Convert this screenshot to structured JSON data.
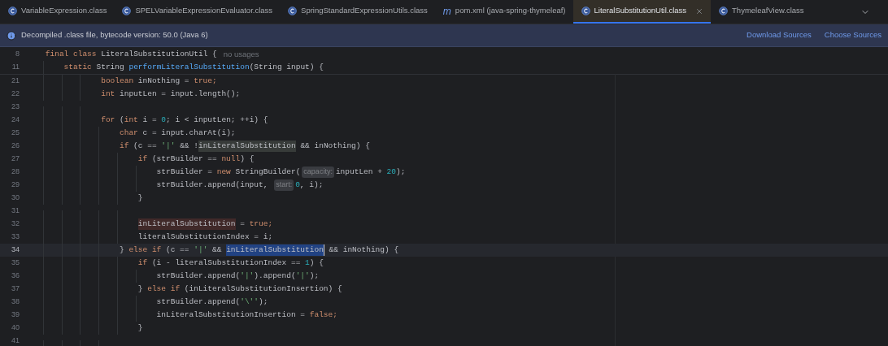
{
  "tabs": [
    {
      "label": "VariableExpression.class",
      "kind": "class",
      "selected": false
    },
    {
      "label": "SPELVariableExpressionEvaluator.class",
      "kind": "class",
      "selected": false
    },
    {
      "label": "SpringStandardExpressionUtils.class",
      "kind": "class",
      "selected": false
    },
    {
      "label": "pom.xml (java-spring-thymeleaf)",
      "kind": "maven",
      "icon_text": "m",
      "selected": false
    },
    {
      "label": "LiteralSubstitutionUtil.class",
      "kind": "class",
      "selected": true
    },
    {
      "label": "ThymeleafView.class",
      "kind": "class",
      "selected": false
    }
  ],
  "banner": {
    "message": "Decompiled .class file, bytecode version: 50.0 (Java 6)",
    "links": [
      "Download Sources",
      "Choose Sources"
    ]
  },
  "sticky_lines": [
    {
      "number": "8",
      "tokens": [
        {
          "kind": "keyword",
          "text": "final class "
        },
        {
          "kind": "plain",
          "text": "LiteralSubstitutionUtil {"
        },
        {
          "kind": "usage",
          "text": "no usages"
        }
      ],
      "children": [
        {
          "number": "11",
          "tokens": [
            {
              "kind": "keyword",
              "text": "static "
            },
            {
              "kind": "plain",
              "text": "String "
            },
            {
              "kind": "method",
              "text": "performLiteralSubstitution"
            },
            {
              "kind": "plain",
              "text": "(String input) {"
            }
          ]
        }
      ]
    }
  ],
  "lines": [
    {
      "number": "21",
      "current": false,
      "tokens": [
        {
          "kind": "keyword",
          "text": "boolean "
        },
        {
          "kind": "plain",
          "text": "inNothing = "
        },
        {
          "kind": "keyword",
          "text": "true;"
        }
      ]
    },
    {
      "number": "22",
      "current": false,
      "tokens": [
        {
          "kind": "keyword",
          "text": "int "
        },
        {
          "kind": "plain",
          "text": "inputLen = input.length();"
        }
      ]
    },
    {
      "number": "23",
      "current": false
    },
    {
      "number": "24",
      "current": false,
      "tokens": [
        {
          "kind": "keyword",
          "text": "for "
        },
        {
          "kind": "plain",
          "text": "("
        },
        {
          "kind": "keyword",
          "text": "int "
        },
        {
          "kind": "plain",
          "text": "i = "
        },
        {
          "kind": "number",
          "text": "0"
        },
        {
          "kind": "plain",
          "text": "; i < inputLen; ++i) {"
        }
      ],
      "children": [
        {
          "number": "25",
          "current": false,
          "tokens": [
            {
              "kind": "keyword",
              "text": "char "
            },
            {
              "kind": "plain",
              "text": "c = input.charAt(i);"
            }
          ]
        },
        {
          "number": "26",
          "current": false,
          "tokens": [
            {
              "kind": "keyword",
              "text": "if "
            },
            {
              "kind": "plain",
              "text": "(c == "
            },
            {
              "kind": "string",
              "text": "'|'"
            },
            {
              "kind": "plain",
              "text": " && !"
            },
            {
              "kind": "read",
              "text": "inLiteralSubstitution"
            },
            {
              "kind": "plain",
              "text": " && inNothing) {"
            }
          ],
          "children": [
            {
              "number": "27",
              "current": false,
              "tokens": [
                {
                  "kind": "keyword",
                  "text": "if "
                },
                {
                  "kind": "plain",
                  "text": "(strBuilder == "
                },
                {
                  "kind": "keyword",
                  "text": "null"
                },
                {
                  "kind": "plain",
                  "text": ") {"
                }
              ],
              "children": [
                {
                  "number": "28",
                  "current": false,
                  "tokens": [
                    {
                      "kind": "plain",
                      "text": "strBuilder = "
                    },
                    {
                      "kind": "keyword",
                      "text": "new "
                    },
                    {
                      "kind": "plain",
                      "text": "StringBuilder("
                    },
                    {
                      "kind": "hint",
                      "text": "capacity:"
                    },
                    {
                      "kind": "plain",
                      "text": "inputLen + "
                    },
                    {
                      "kind": "number",
                      "text": "20"
                    },
                    {
                      "kind": "plain",
                      "text": ");"
                    }
                  ]
                },
                {
                  "number": "29",
                  "current": false,
                  "tokens": [
                    {
                      "kind": "plain",
                      "text": "strBuilder.append(input, "
                    },
                    {
                      "kind": "hint",
                      "text": "start:"
                    },
                    {
                      "kind": "number",
                      "text": "0"
                    },
                    {
                      "kind": "plain",
                      "text": ", i);"
                    }
                  ]
                }
              ]
            },
            {
              "number": "30",
              "current": false,
              "tokens": [
                {
                  "kind": "plain",
                  "text": "}"
                }
              ]
            },
            {
              "number": "31",
              "current": false
            },
            {
              "number": "32",
              "current": false,
              "tokens": [
                {
                  "kind": "write",
                  "text": "inLiteralSubstitution"
                },
                {
                  "kind": "plain",
                  "text": " = "
                },
                {
                  "kind": "keyword",
                  "text": "true;"
                }
              ]
            },
            {
              "number": "33",
              "current": false,
              "tokens": [
                {
                  "kind": "plain",
                  "text": "literalSubstitutionIndex = i;"
                }
              ]
            }
          ]
        },
        {
          "number": "34",
          "current": true,
          "tokens": [
            {
              "kind": "plain",
              "text": "} "
            },
            {
              "kind": "keyword",
              "text": "else if "
            },
            {
              "kind": "plain",
              "text": "(c == "
            },
            {
              "kind": "string",
              "text": "'|'"
            },
            {
              "kind": "plain",
              "text": " && "
            },
            {
              "kind": "selection",
              "text": "inLiteralSubstitution"
            },
            {
              "kind": "plain",
              "text": " && inNothing) {"
            }
          ],
          "children": [
            {
              "number": "35",
              "current": false,
              "tokens": [
                {
                  "kind": "keyword",
                  "text": "if "
                },
                {
                  "kind": "plain",
                  "text": "(i - literalSubstitutionIndex == "
                },
                {
                  "kind": "number",
                  "text": "1"
                },
                {
                  "kind": "plain",
                  "text": ") {"
                }
              ],
              "children": [
                {
                  "number": "36",
                  "current": false,
                  "tokens": [
                    {
                      "kind": "plain",
                      "text": "strBuilder.append("
                    },
                    {
                      "kind": "string",
                      "text": "'|'"
                    },
                    {
                      "kind": "plain",
                      "text": ").append("
                    },
                    {
                      "kind": "string",
                      "text": "'|'"
                    },
                    {
                      "kind": "plain",
                      "text": ");"
                    }
                  ]
                }
              ]
            },
            {
              "number": "37",
              "current": false,
              "tokens": [
                {
                  "kind": "plain",
                  "text": "} "
                },
                {
                  "kind": "keyword",
                  "text": "else if "
                },
                {
                  "kind": "plain",
                  "text": "(inLiteralSubstitutionInsertion) {"
                }
              ],
              "children": [
                {
                  "number": "38",
                  "current": false,
                  "tokens": [
                    {
                      "kind": "plain",
                      "text": "strBuilder.append("
                    },
                    {
                      "kind": "string",
                      "text": "'\\''"
                    },
                    {
                      "kind": "plain",
                      "text": ");"
                    }
                  ]
                },
                {
                  "number": "39",
                  "current": false,
                  "tokens": [
                    {
                      "kind": "plain",
                      "text": "inLiteralSubstitutionInsertion = "
                    },
                    {
                      "kind": "keyword",
                      "text": "false;"
                    }
                  ]
                }
              ]
            },
            {
              "number": "40",
              "current": false,
              "tokens": [
                {
                  "kind": "plain",
                  "text": "}"
                }
              ]
            }
          ]
        },
        {
          "number": "41",
          "current": false
        }
      ]
    }
  ]
}
